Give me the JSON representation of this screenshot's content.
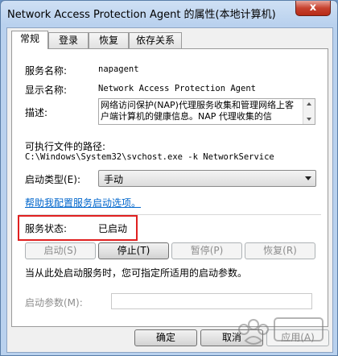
{
  "window": {
    "title": "Network Access Protection Agent 的属性(本地计算机)",
    "close_label": "x"
  },
  "tabs": [
    {
      "label": "常规",
      "active": true
    },
    {
      "label": "登录",
      "active": false
    },
    {
      "label": "恢复",
      "active": false
    },
    {
      "label": "依存关系",
      "active": false
    }
  ],
  "general": {
    "service_name_label": "服务名称:",
    "service_name_value": "napagent",
    "display_name_label": "显示名称:",
    "display_name_value": "Network Access Protection Agent",
    "description_label": "描述:",
    "description_value": "网络访问保护(NAP)代理服务收集和管理网络上客户端计算机的健康信息。NAP 代理收集的信",
    "exec_path_label": "可执行文件的路径:",
    "exec_path_value": "C:\\Windows\\System32\\svchost.exe -k NetworkService",
    "startup_type_label": "启动类型(E):",
    "startup_type_value": "手动",
    "help_link": "帮助我配置服务启动选项。",
    "status_label": "服务状态:",
    "status_value": "已启动",
    "hint_text": "当从此处启动服务时，您可指定所适用的启动参数。",
    "start_params_label": "启动参数(M):",
    "start_params_value": ""
  },
  "service_buttons": {
    "start": "启动(S)",
    "stop": "停止(T)",
    "pause": "暂停(P)",
    "resume": "恢复(R)"
  },
  "dialog_buttons": {
    "ok": "确定",
    "cancel": "取消",
    "apply": "应用(A)"
  },
  "colors": {
    "highlight": "#e02020",
    "link": "#0066cc"
  }
}
